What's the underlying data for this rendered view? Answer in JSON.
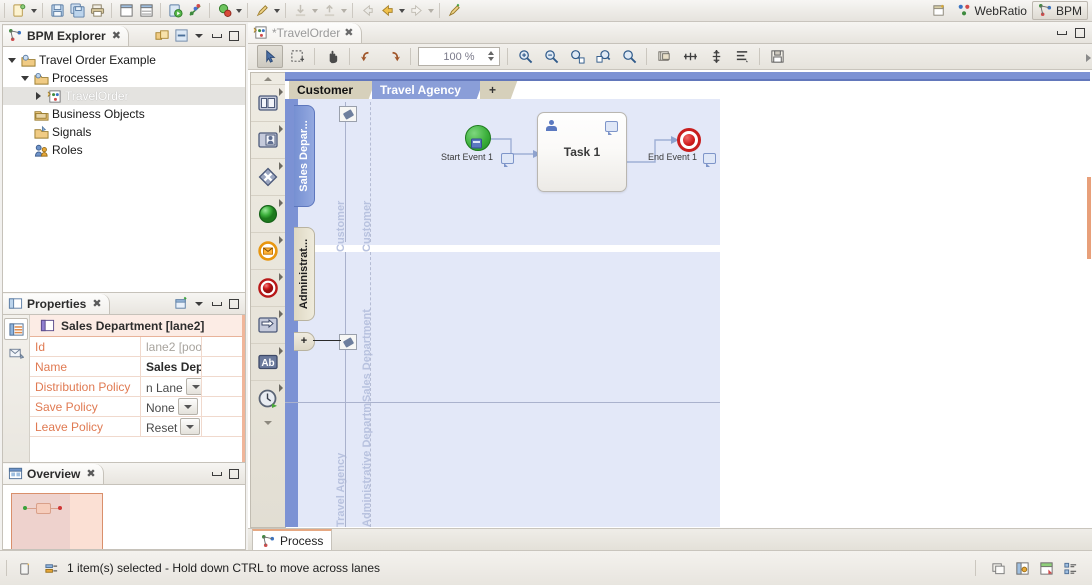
{
  "toolbar": {
    "buttons": [
      {
        "name": "new-wizard",
        "icon": "new-file-icon",
        "menu": true
      },
      {
        "name": "save",
        "icon": "save-icon",
        "menu": false
      },
      {
        "name": "save-all",
        "icon": "save-all-icon",
        "menu": false
      },
      {
        "name": "print",
        "icon": "print-icon",
        "menu": false
      },
      {
        "name": "new-page",
        "icon": "page-icon",
        "menu": false
      },
      {
        "name": "new-layout",
        "icon": "layout-icon",
        "menu": false
      },
      {
        "name": "run",
        "icon": "run-icon",
        "menu": false
      },
      {
        "name": "generate",
        "icon": "generate-icon",
        "menu": false
      },
      {
        "name": "debug",
        "icon": "debug-icon",
        "menu": true
      },
      {
        "name": "brush",
        "icon": "brush-icon",
        "menu": true
      },
      {
        "name": "import",
        "icon": "import-icon",
        "menu": true,
        "disabled": true
      },
      {
        "name": "export",
        "icon": "export-icon",
        "menu": true,
        "disabled": true
      },
      {
        "name": "back",
        "icon": "back-arrow-icon",
        "menu": false,
        "disabled": true
      },
      {
        "name": "previous",
        "icon": "left-arrow-icon",
        "menu": true
      },
      {
        "name": "next",
        "icon": "right-arrow-icon",
        "menu": true,
        "disabled": true
      },
      {
        "name": "new-marker",
        "icon": "pencil-icon",
        "menu": false
      }
    ],
    "perspectives": [
      {
        "label": "",
        "icon": "open-perspective-icon",
        "active": false
      },
      {
        "label": "WebRatio",
        "icon": "webratio-icon",
        "active": false
      },
      {
        "label": "BPM",
        "icon": "bpm-icon",
        "active": true
      }
    ]
  },
  "explorer": {
    "tab_label": "BPM Explorer",
    "close_glyph": "✖",
    "tools": [
      "link-with-editor-icon",
      "collapse-all-icon",
      "view-menu-icon",
      "minimize-icon",
      "maximize-icon"
    ],
    "tree": [
      {
        "label": "Travel Order Example",
        "icon": "project-icon",
        "indent": 0,
        "twisty": "open",
        "selected": false
      },
      {
        "label": "Processes",
        "icon": "folder-processes-icon",
        "indent": 1,
        "twisty": "open",
        "selected": false
      },
      {
        "label": "TravelOrder",
        "icon": "process-icon",
        "indent": 2,
        "twisty": "closed",
        "selected": true
      },
      {
        "label": "Business Objects",
        "icon": "folder-objects-icon",
        "indent": 1,
        "twisty": "none",
        "selected": false
      },
      {
        "label": "Signals",
        "icon": "folder-signals-icon",
        "indent": 1,
        "twisty": "none",
        "selected": false
      },
      {
        "label": "Roles",
        "icon": "roles-icon",
        "indent": 1,
        "twisty": "none",
        "selected": false
      }
    ]
  },
  "properties": {
    "tab_label": "Properties",
    "close_glyph": "✖",
    "tools": [
      "pin-icon",
      "view-menu-icon",
      "minimize-icon",
      "maximize-icon"
    ],
    "side_tabs": [
      "general-tab-icon",
      "documentation-tab-icon"
    ],
    "header": "Sales Department [lane2]",
    "header_icon": "lane-icon",
    "rows": [
      {
        "key": "Id",
        "value": "lane2  [poo",
        "style": "dim",
        "combo": false
      },
      {
        "key": "Name",
        "value": "Sales Depa",
        "style": "bold",
        "combo": false
      },
      {
        "key": "Distribution Policy",
        "value": "n Lane",
        "style": "norm",
        "combo": true
      },
      {
        "key": "Save Policy",
        "value": "None",
        "style": "norm",
        "combo": true
      },
      {
        "key": "Leave Policy",
        "value": "Reset",
        "style": "norm",
        "combo": true
      }
    ]
  },
  "overview": {
    "tab_label": "Overview",
    "close_glyph": "✖",
    "tools": [
      "minimize-icon",
      "maximize-icon"
    ]
  },
  "editor": {
    "tab_label": "*TravelOrder",
    "tab_icon": "process-icon",
    "close_glyph": "✖",
    "win_tools": [
      "minimize-icon",
      "maximize-icon"
    ],
    "toolbar": {
      "zoom_value": "100 %",
      "buttons": [
        {
          "name": "select-tool",
          "icon": "arrow-select-icon",
          "active": true
        },
        {
          "name": "marquee-tool",
          "icon": "marquee-icon",
          "active": false
        },
        {
          "name": "pan-tool",
          "icon": "hand-icon",
          "active": false
        },
        {
          "name": "undo",
          "icon": "undo-arrow-icon",
          "active": false
        },
        {
          "name": "redo",
          "icon": "redo-arrow-icon",
          "active": false
        },
        {
          "name": "zoom-in",
          "icon": "zoom-in-icon",
          "active": false
        },
        {
          "name": "zoom-out",
          "icon": "zoom-out-icon",
          "active": false
        },
        {
          "name": "zoom-fit-page",
          "icon": "zoom-fit-page-icon",
          "active": false
        },
        {
          "name": "zoom-fit-width",
          "icon": "zoom-fit-width-icon",
          "active": false
        },
        {
          "name": "zoom-actual",
          "icon": "zoom-actual-icon",
          "active": false
        },
        {
          "name": "snap-to-grid",
          "icon": "grid-icon",
          "active": false
        },
        {
          "name": "distribute-horizontal",
          "icon": "distribute-h-icon",
          "active": false
        },
        {
          "name": "distribute-vertical",
          "icon": "distribute-v-icon",
          "active": false
        },
        {
          "name": "align-list",
          "icon": "align-list-icon",
          "active": false
        },
        {
          "name": "save-image",
          "icon": "save-image-icon",
          "active": false
        }
      ]
    },
    "palette": [
      {
        "name": "pool-tool",
        "icon": "pool-icon"
      },
      {
        "name": "lane-tool",
        "icon": "lane-icon"
      },
      {
        "name": "gateway-tool",
        "icon": "gateway-icon"
      },
      {
        "name": "start-event-tool",
        "icon": "start-event-icon"
      },
      {
        "name": "intermediate-event-tool",
        "icon": "message-event-icon"
      },
      {
        "name": "end-event-tool",
        "icon": "end-event-icon"
      },
      {
        "name": "sequence-flow-tool",
        "icon": "sequence-flow-icon"
      },
      {
        "name": "text-annotation-tool",
        "icon": "text-annotation-icon"
      },
      {
        "name": "timer-event-tool",
        "icon": "timer-event-icon"
      }
    ],
    "bottom_tab": {
      "label": "Process",
      "icon": "process-diagram-icon"
    }
  },
  "diagram": {
    "pool_tabs": [
      {
        "label": "Customer",
        "selected": false
      },
      {
        "label": "Travel Agency",
        "selected": true
      },
      {
        "label": "+",
        "selected": false
      }
    ],
    "lane_tabs": [
      {
        "label": "Sales Depar...",
        "selected": true
      },
      {
        "label": "Administrat...",
        "selected": false
      }
    ],
    "add_lane_label": "+",
    "watermarks": [
      {
        "text": "Customer"
      },
      {
        "text": "Customer"
      },
      {
        "text": "Sales Department"
      },
      {
        "text": "Travel Agency"
      },
      {
        "text": "Administrative Departm"
      }
    ],
    "nodes": [
      {
        "name": "start-event",
        "label": "Start Event 1",
        "type": "start"
      },
      {
        "name": "task",
        "label": "Task 1",
        "type": "user-task"
      },
      {
        "name": "end-event",
        "label": "End Event 1",
        "type": "end"
      }
    ]
  },
  "statusbar": {
    "message": "1 item(s) selected - Hold down CTRL to move across lanes",
    "left_icons": [
      "resource-icon",
      "selection-icon"
    ],
    "right_icons": [
      "tile-icon",
      "perspective1-icon",
      "perspective2-icon",
      "outline-icon"
    ]
  },
  "colors": {
    "accent_blue": "#7c92d4",
    "pool_fill": "#e3e8f8",
    "lane_tab": "#ded8c3",
    "prop_header": "#fcece5",
    "prop_key": "#e07a52",
    "start_green": "#3cb03c",
    "end_red": "#c81e1e"
  }
}
